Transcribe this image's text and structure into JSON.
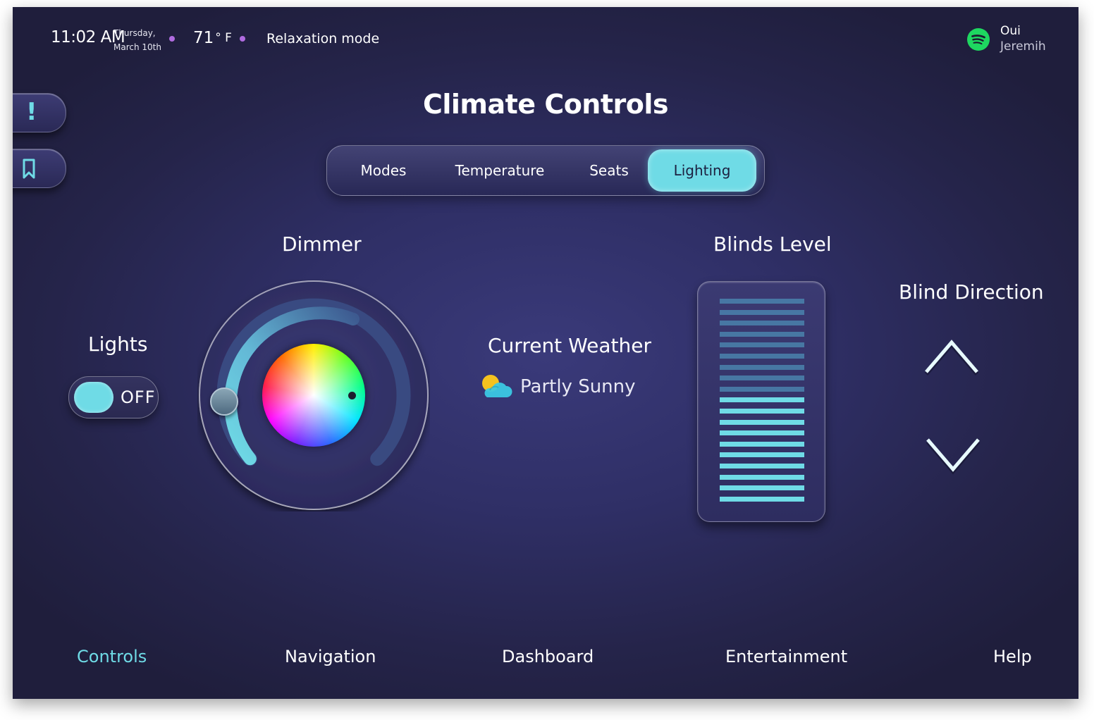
{
  "status": {
    "time": "11:02 AM",
    "weekday": "Thursday,",
    "date": "March 10th",
    "temperature": "71",
    "temperature_unit": "° F",
    "mode": "Relaxation mode"
  },
  "music": {
    "song": "Oui",
    "artist": "Jeremih",
    "icon": "spotify-icon",
    "icon_color": "#1ed760"
  },
  "sidebar": {
    "items": [
      {
        "icon": "alert-icon",
        "glyph": "!"
      },
      {
        "icon": "bookmark-icon"
      }
    ]
  },
  "page": {
    "title": "Climate Controls"
  },
  "tabs": [
    {
      "label": "Modes",
      "active": false
    },
    {
      "label": "Temperature",
      "active": false
    },
    {
      "label": "Seats",
      "active": false
    },
    {
      "label": "Lighting",
      "active": true
    }
  ],
  "lights": {
    "label": "Lights",
    "state": "OFF"
  },
  "dimmer": {
    "label": "Dimmer",
    "level": 0.1
  },
  "weather": {
    "label": "Current Weather",
    "condition": "Partly Sunny"
  },
  "blinds": {
    "label": "Blinds Level",
    "slat_count": 19,
    "lowered_slats": 10
  },
  "blind_direction": {
    "label": "Blind Direction"
  },
  "nav": [
    {
      "label": "Controls",
      "active": true
    },
    {
      "label": "Navigation",
      "active": false
    },
    {
      "label": "Dashboard",
      "active": false
    },
    {
      "label": "Entertainment",
      "active": false
    },
    {
      "label": "Help",
      "active": false
    }
  ],
  "colors": {
    "accent": "#6fdbe6",
    "status_dot": "#b06be0",
    "background": "#2f2f66"
  }
}
